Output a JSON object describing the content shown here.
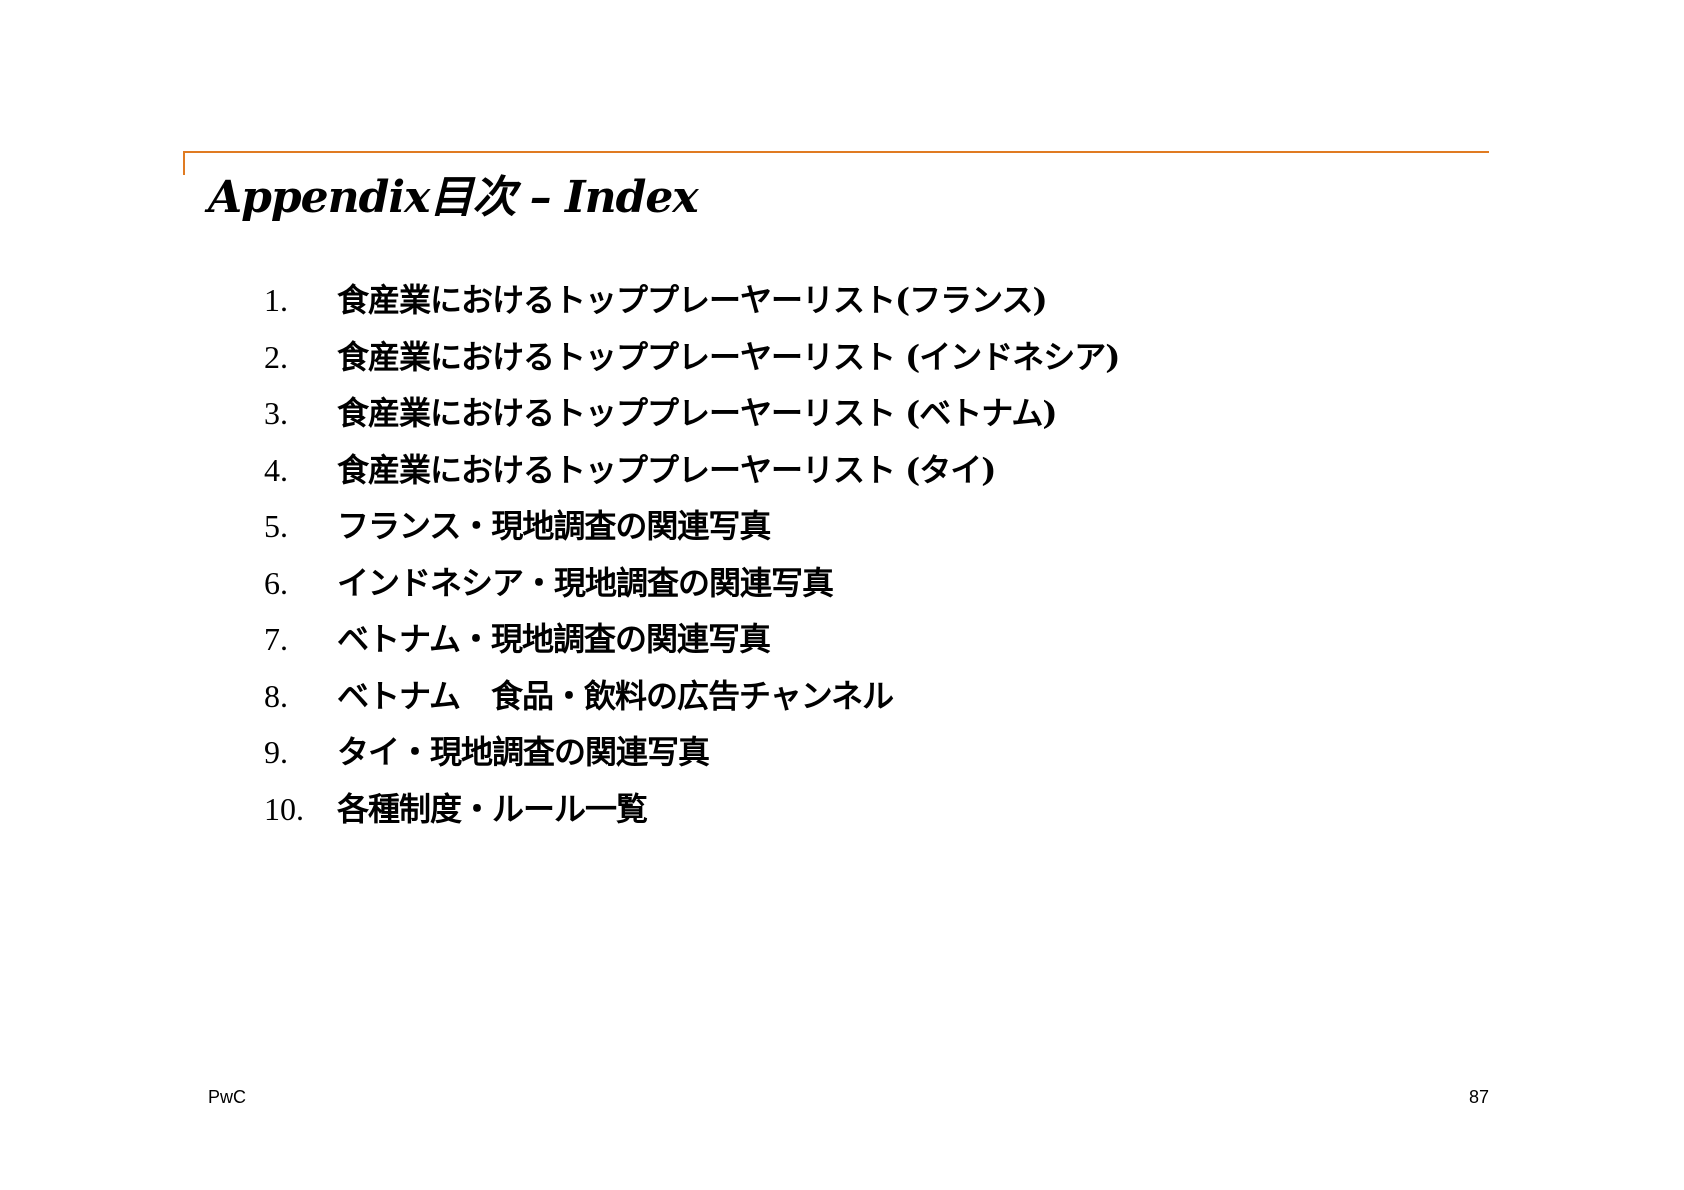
{
  "title": "Appendix目次 – Index",
  "items": [
    {
      "num": "1.",
      "text": "食産業におけるトッププレーヤーリスト(フランス)"
    },
    {
      "num": "2.",
      "text": "食産業におけるトッププレーヤーリスト (インドネシア)"
    },
    {
      "num": "3.",
      "text": "食産業におけるトッププレーヤーリスト (ベトナム)"
    },
    {
      "num": "4.",
      "text": "食産業におけるトッププレーヤーリスト (タイ)"
    },
    {
      "num": "5.",
      "text": "フランス・現地調査の関連写真"
    },
    {
      "num": "6.",
      "text": "インドネシア・現地調査の関連写真"
    },
    {
      "num": "7.",
      "text": "ベトナム・現地調査の関連写真"
    },
    {
      "num": "8.",
      "text": "ベトナム　食品・飲料の広告チャンネル"
    },
    {
      "num": "9.",
      "text": "タイ・現地調査の関連写真"
    },
    {
      "num": "10.",
      "text": "各種制度・ルール一覧"
    }
  ],
  "footer": {
    "brand": "PwC",
    "page_number": "87"
  },
  "colors": {
    "accent": "#E07B22",
    "text": "#000000",
    "background": "#FFFFFF"
  }
}
